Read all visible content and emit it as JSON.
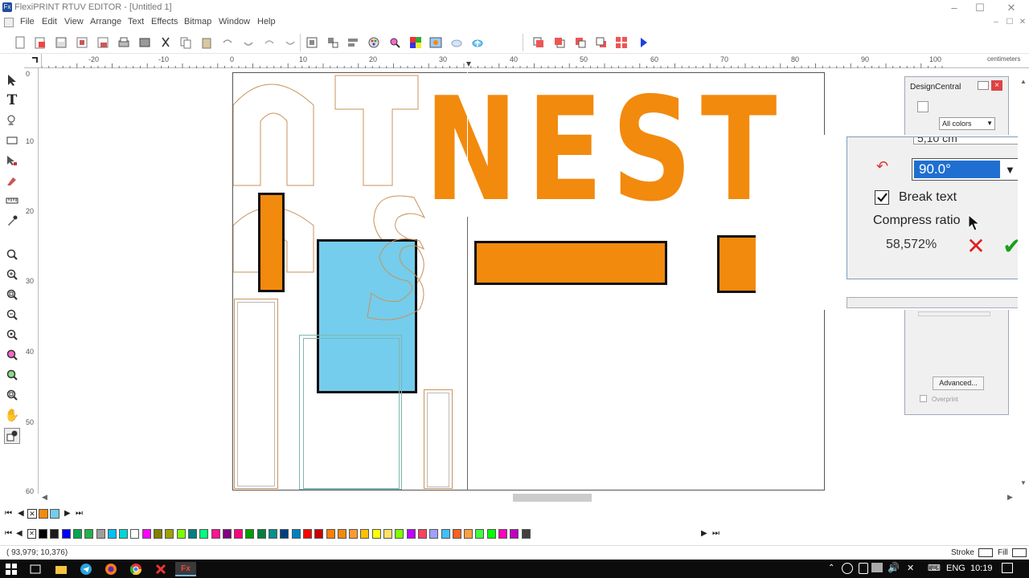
{
  "window": {
    "title": "FlexiPRINT RTUV EDITOR - [Untitled 1]",
    "app_badge": "Fx",
    "minimize": "–",
    "maximize": "☐",
    "close": "✕"
  },
  "menu": [
    "File",
    "Edit",
    "View",
    "Arrange",
    "Text",
    "Effects",
    "Bitmap",
    "Window",
    "Help"
  ],
  "ruler": {
    "unit": "centimeters",
    "h_ticks": [
      "-20",
      "-10",
      "0",
      "10",
      "20",
      "30",
      "40",
      "50",
      "60",
      "70",
      "80",
      "90",
      "100"
    ],
    "v_ticks": [
      "0",
      "10",
      "20",
      "30",
      "40",
      "50",
      "60"
    ]
  },
  "canvas": {
    "text_main": "NEST",
    "text_outline": "NT",
    "text_outline_2": "ns"
  },
  "design_central": {
    "title": "DesignCentral",
    "filter": "All colors",
    "advanced_label": "Advanced...",
    "overprint_label": "Overprint",
    "close_icon": "×"
  },
  "zoom_panel": {
    "cropped_value": "5,10 cm",
    "rotation_value": "90.0°",
    "break_text_label": "Break text",
    "break_text_checked": true,
    "compress_label": "Compress ratio",
    "compress_value": "58,572%",
    "cancel": "✕",
    "ok": "✔"
  },
  "status": {
    "coords": "( 93,979;  10,376)",
    "stroke_label": "Stroke",
    "fill_label": "Fill"
  },
  "colors": {
    "orange": "#f28a0d",
    "cyan": "#74cdec",
    "accent_blue": "#1f6fd1",
    "outline_brown": "#c9935a",
    "outline_teal": "#7fb7b0"
  },
  "palette": [
    "#000000",
    "#1b1b1b",
    "#0000ff",
    "#00a651",
    "#22b14c",
    "#9e9e9e",
    "#00c0ff",
    "#00d7d7",
    "#ffffff",
    "#ff00ff",
    "#808000",
    "#a0a000",
    "#7fff00",
    "#008080",
    "#00ff7f",
    "#ff1493",
    "#800080",
    "#ff0080",
    "#00a000",
    "#008040",
    "#009090",
    "#004080",
    "#0080c0",
    "#ff0000",
    "#cc0000",
    "#ff8000",
    "#f28a0d",
    "#ff9a33",
    "#ffc000",
    "#ffff00",
    "#ffe066",
    "#80ff00",
    "#c000ff",
    "#ff4060",
    "#a0a0ff",
    "#40c0ff",
    "#ff6020",
    "#ffa040",
    "#40ff40",
    "#00ff00",
    "#ff00c0",
    "#c000c0",
    "#404040"
  ],
  "taskbar": {
    "lang": "ENG",
    "time": "10:19"
  }
}
